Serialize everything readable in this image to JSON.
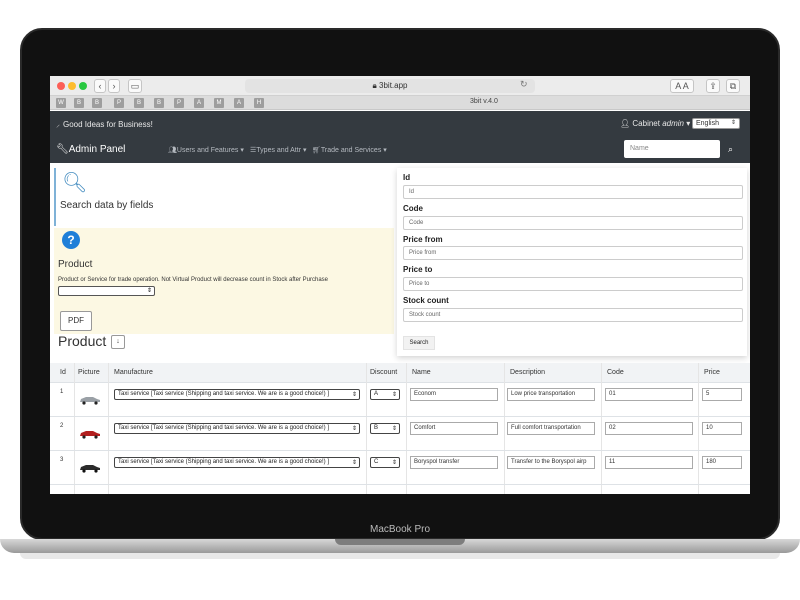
{
  "device": {
    "label": "MacBook Pro"
  },
  "browser": {
    "url": "3bit.app",
    "tab_title": "3bit v.4.0",
    "bookmarks": [
      "W",
      "B",
      "B",
      "P",
      "B",
      "B",
      "P",
      "A",
      "M",
      "A",
      "H"
    ],
    "font_buttons": [
      "A",
      "A"
    ]
  },
  "navbar": {
    "brand": "Good Ideas for Business!",
    "cabinet_prefix": "Cabinet",
    "cabinet_user": "admin",
    "language": "English",
    "admin_panel": "Admin Panel",
    "menu": [
      "Users and Features",
      "Types and Attr",
      "Trade and Services"
    ],
    "search_placeholder": "Name"
  },
  "search_panel": {
    "title": "Search data by fields"
  },
  "product_info": {
    "title": "Product",
    "description": "Product or Service for trade operation. Not Virtual Product will decrease count in Stock after Purchase",
    "pdf_label": "PDF",
    "heading": "Product",
    "sort_symbol": "↓"
  },
  "filter_form": {
    "fields": [
      {
        "label": "Id",
        "placeholder": "Id"
      },
      {
        "label": "Code",
        "placeholder": "Code"
      },
      {
        "label": "Price from",
        "placeholder": "Price from"
      },
      {
        "label": "Price to",
        "placeholder": "Price to"
      },
      {
        "label": "Stock count",
        "placeholder": "Stock count"
      }
    ],
    "search_button": "Search"
  },
  "table": {
    "headers": [
      "Id",
      "Picture",
      "Manufacture",
      "Discount",
      "Name",
      "Description",
      "Code",
      "Price"
    ],
    "rows": [
      {
        "id": "1",
        "car_color": "#9aa0a6",
        "manufacture": "Taxi service [Taxi service (Shipping and taxi service. We are is a good choice!) ]",
        "discount": "A",
        "name": "Econom",
        "description": "Low price transportation",
        "code": "01",
        "price": "5"
      },
      {
        "id": "2",
        "car_color": "#b21f1f",
        "manufacture": "Taxi service [Taxi service (Shipping and taxi service. We are is a good choice!) ]",
        "discount": "B",
        "name": "Comfort",
        "description": "Full comfort transportation",
        "code": "02",
        "price": "10"
      },
      {
        "id": "3",
        "car_color": "#2b2b2b",
        "manufacture": "Taxi service [Taxi service (Shipping and taxi service. We are is a good choice!) ]",
        "discount": "C",
        "name": "Boryspol transfer",
        "description": "Transfer to the Boryspol airp",
        "code": "11",
        "price": "180"
      }
    ]
  }
}
